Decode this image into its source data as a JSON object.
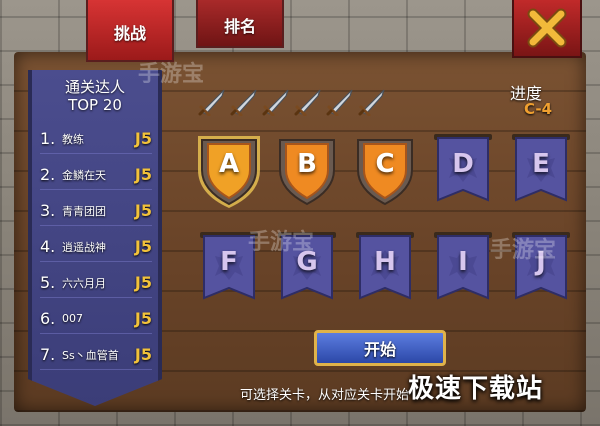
{
  "tabs": [
    {
      "label": "挑战",
      "active": true
    },
    {
      "label": "排名",
      "active": false
    }
  ],
  "close_icon": "close-x-icon",
  "leaderboard": {
    "title_line1": "通关达人",
    "title_line2": "TOP 20",
    "rows": [
      {
        "rank": "1.",
        "name": "教练",
        "level": "J5"
      },
      {
        "rank": "2.",
        "name": "金鳞在天",
        "level": "J5"
      },
      {
        "rank": "3.",
        "name": "青青团团",
        "level": "J5"
      },
      {
        "rank": "4.",
        "name": "逍遥战神",
        "level": "J5"
      },
      {
        "rank": "5.",
        "name": "六六月月",
        "level": "J5"
      },
      {
        "rank": "6.",
        "name": "007",
        "level": "J5"
      },
      {
        "rank": "7.",
        "name": "Ss丶血管首",
        "level": "J5"
      }
    ]
  },
  "swords_count": 6,
  "progress": {
    "label": "进度",
    "value": "C-4"
  },
  "stages": [
    {
      "letter": "A",
      "state": "selected"
    },
    {
      "letter": "B",
      "state": "unlocked"
    },
    {
      "letter": "C",
      "state": "unlocked"
    },
    {
      "letter": "D",
      "state": "locked"
    },
    {
      "letter": "E",
      "state": "locked"
    },
    {
      "letter": "F",
      "state": "locked"
    },
    {
      "letter": "G",
      "state": "locked"
    },
    {
      "letter": "H",
      "state": "locked"
    },
    {
      "letter": "I",
      "state": "locked"
    },
    {
      "letter": "J",
      "state": "locked"
    }
  ],
  "start_button": "开始",
  "hint": "可选择关卡，从对应关卡开始",
  "watermark": {
    "site": "极速下载站",
    "brand": "手游宝"
  },
  "colors": {
    "gold": "#f2c23a",
    "tab_red": "#c12a2a",
    "banner_blue": "#4b4d8e",
    "shield_orange": "#f08a1e"
  }
}
